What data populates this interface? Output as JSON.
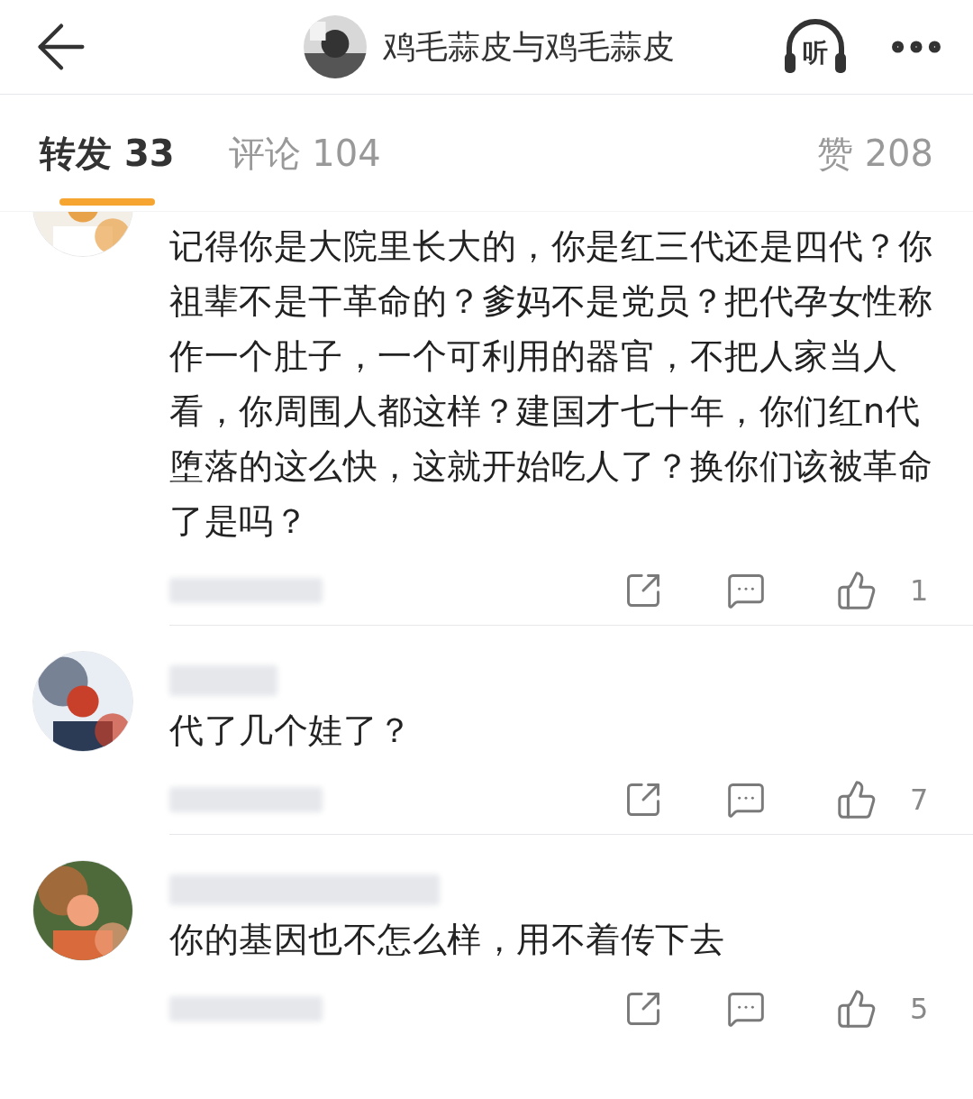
{
  "header": {
    "title": "鸡毛蒜皮与鸡毛蒜皮",
    "listen_label": "听"
  },
  "tabs": [
    {
      "label": "转发 33",
      "selected": true
    },
    {
      "label": "评论 104",
      "selected": false
    },
    {
      "label": "赞 208",
      "selected": false
    }
  ],
  "comments": [
    {
      "text": "记得你是大院里长大的，你是红三代还是四代？你祖辈不是干革命的？爹妈不是党员？把代孕女性称作一个肚子，一个可利用的器官，不把人家当人看，你周围人都这样？建国才七十年，你们红n代堕落的这么快，这就开始吃人了？换你们该被革命了是吗？",
      "likes": "1"
    },
    {
      "text": "代了几个娃了？",
      "likes": "7"
    },
    {
      "text": "你的基因也不怎么样，用不着传下去",
      "likes": "5"
    }
  ]
}
